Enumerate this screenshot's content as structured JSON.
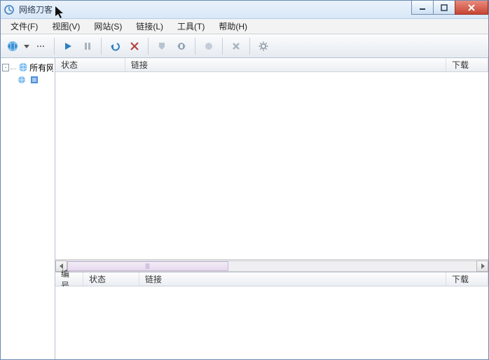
{
  "title": "网络刀客",
  "menu": {
    "file": "文件(F)",
    "view": "视图(V)",
    "site": "网站(S)",
    "link": "链接(L)",
    "tool": "工具(T)",
    "help": "帮助(H)"
  },
  "sidebar": {
    "root_label": "所有网",
    "child_toggle": "-"
  },
  "top_list": {
    "columns": {
      "status": "状态",
      "link": "链接",
      "download": "下载"
    }
  },
  "bottom_list": {
    "columns": {
      "no": "编号",
      "status": "状态",
      "link": "链接",
      "download": "下载"
    }
  },
  "tree_toggle_glyph": "-"
}
